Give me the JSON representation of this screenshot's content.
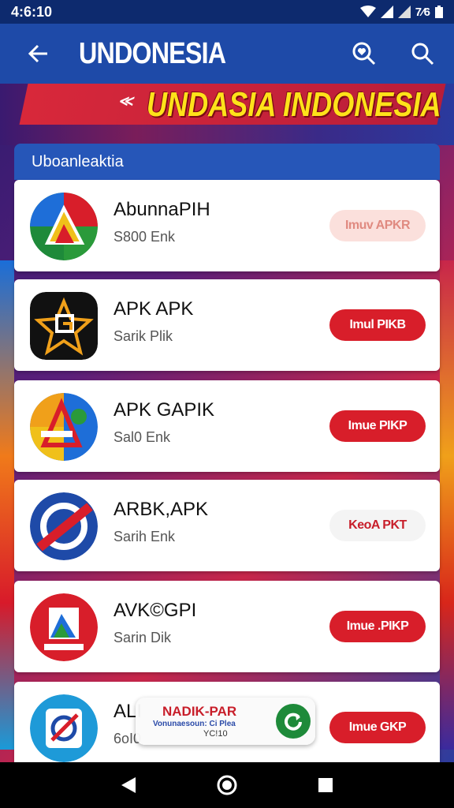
{
  "status_bar": {
    "time": "4:6:10",
    "battery_text": "7⁄6"
  },
  "app_bar": {
    "title": "UNDONESIA"
  },
  "banner": {
    "text": "UNDASIA INDONESIA",
    "mark": "≪"
  },
  "panel": {
    "header": "Uboanleaktia"
  },
  "apps": [
    {
      "name": "AbunnaPIH",
      "sub": "S800 Enk",
      "button": "Imuv APKR"
    },
    {
      "name": "APK APK",
      "sub": "Sarik Plik",
      "button": "Imul PIKB"
    },
    {
      "name": "APK GAPIK",
      "sub": "Sal0 Enk",
      "button": "Imue PIKP"
    },
    {
      "name": "ARBK,APK",
      "sub": "Sarih Enk",
      "button": "KeoA PKT"
    },
    {
      "name": "AVK©GPI",
      "sub": "Sarin Dik",
      "button": "Imue .PIKP"
    },
    {
      "name": "ALI",
      "sub": "6oI0",
      "button": "Imue GKP"
    }
  ],
  "toast": {
    "title": "NADIK-PAR",
    "line1": "Vonunaesoun: Ci Plea",
    "line2": "YC!10"
  },
  "colors": {
    "primary": "#1e4aa8",
    "accent": "#d81e2a",
    "banner_text": "#ffe21a"
  }
}
